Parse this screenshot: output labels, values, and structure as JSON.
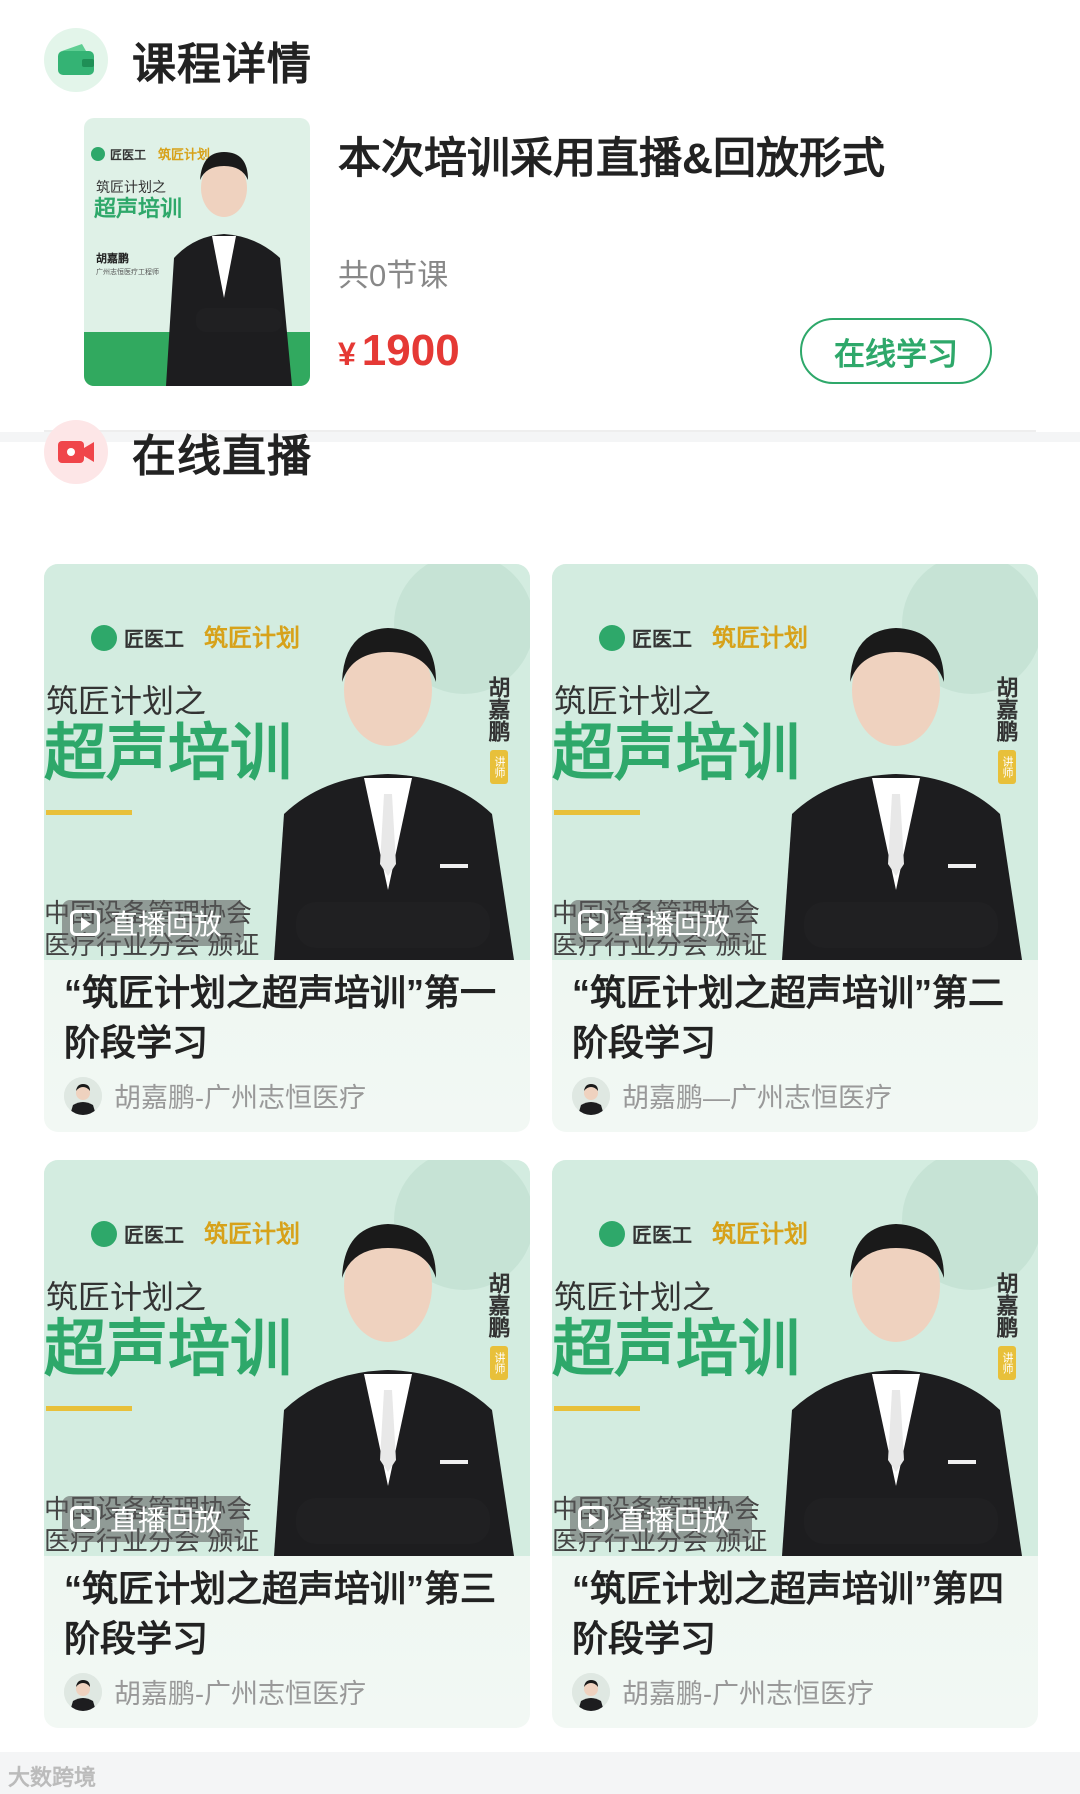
{
  "course_section": {
    "title": "课程详情",
    "course_title": "本次培训采用直播&回放形式",
    "lesson_count": "共0节课",
    "currency": "¥",
    "price": "1900",
    "study_button": "在线学习",
    "cover": {
      "brand": "匠医工",
      "plan": "筑匠计划",
      "subtitle": "筑匠计划之",
      "headline": "超声培训",
      "lecturer": "胡嘉鹏",
      "lecturer_org": "广州志恒医疗工程师"
    }
  },
  "live_section": {
    "title": "在线直播",
    "badge_label": "直播回放",
    "thumb": {
      "brand": "匠医工",
      "plan": "筑匠计划",
      "subtitle": "筑匠计划之",
      "headline": "超声培训",
      "lecturer_vertical": "胡嘉鹏",
      "lecturer_tag": "讲师",
      "footer_line1": "中国设备管理协会",
      "footer_line2": "医疗行业分会 颁证"
    },
    "videos": [
      {
        "title": "“筑匠计划之超声培训”第一阶段学习",
        "author": "胡嘉鹏-广州志恒医疗"
      },
      {
        "title": "“筑匠计划之超声培训”第二阶段学习",
        "author": "胡嘉鹏—广州志恒医疗"
      },
      {
        "title": "“筑匠计划之超声培训”第三阶段学习",
        "author": "胡嘉鹏-广州志恒医疗"
      },
      {
        "title": "“筑匠计划之超声培训”第四阶段学习",
        "author": "胡嘉鹏-广州志恒医疗"
      }
    ]
  },
  "watermark": "大数跨境",
  "colors": {
    "accent_green": "#2ea86a",
    "price_red": "#e53935",
    "thumb_bg": "#d3ece0",
    "live_icon_red": "#f0454a"
  }
}
